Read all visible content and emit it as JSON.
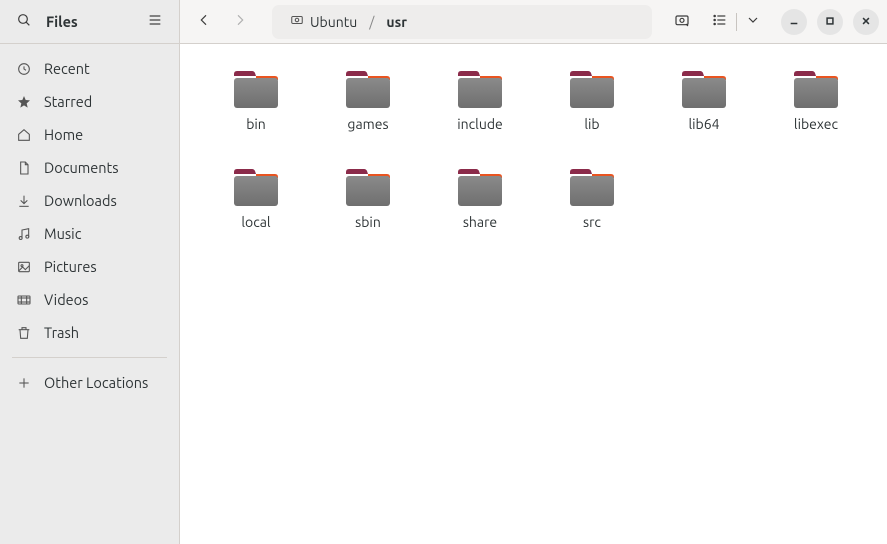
{
  "app": {
    "title": "Files"
  },
  "path": {
    "root_label": "Ubuntu",
    "current": "usr"
  },
  "sidebar": {
    "items": [
      {
        "id": "recent",
        "label": "Recent"
      },
      {
        "id": "starred",
        "label": "Starred"
      },
      {
        "id": "home",
        "label": "Home"
      },
      {
        "id": "documents",
        "label": "Documents"
      },
      {
        "id": "downloads",
        "label": "Downloads"
      },
      {
        "id": "music",
        "label": "Music"
      },
      {
        "id": "pictures",
        "label": "Pictures"
      },
      {
        "id": "videos",
        "label": "Videos"
      },
      {
        "id": "trash",
        "label": "Trash"
      }
    ],
    "other_locations_label": "Other Locations"
  },
  "folders": [
    {
      "name": "bin"
    },
    {
      "name": "games"
    },
    {
      "name": "include"
    },
    {
      "name": "lib"
    },
    {
      "name": "lib64"
    },
    {
      "name": "libexec"
    },
    {
      "name": "local"
    },
    {
      "name": "sbin"
    },
    {
      "name": "share"
    },
    {
      "name": "src"
    }
  ]
}
